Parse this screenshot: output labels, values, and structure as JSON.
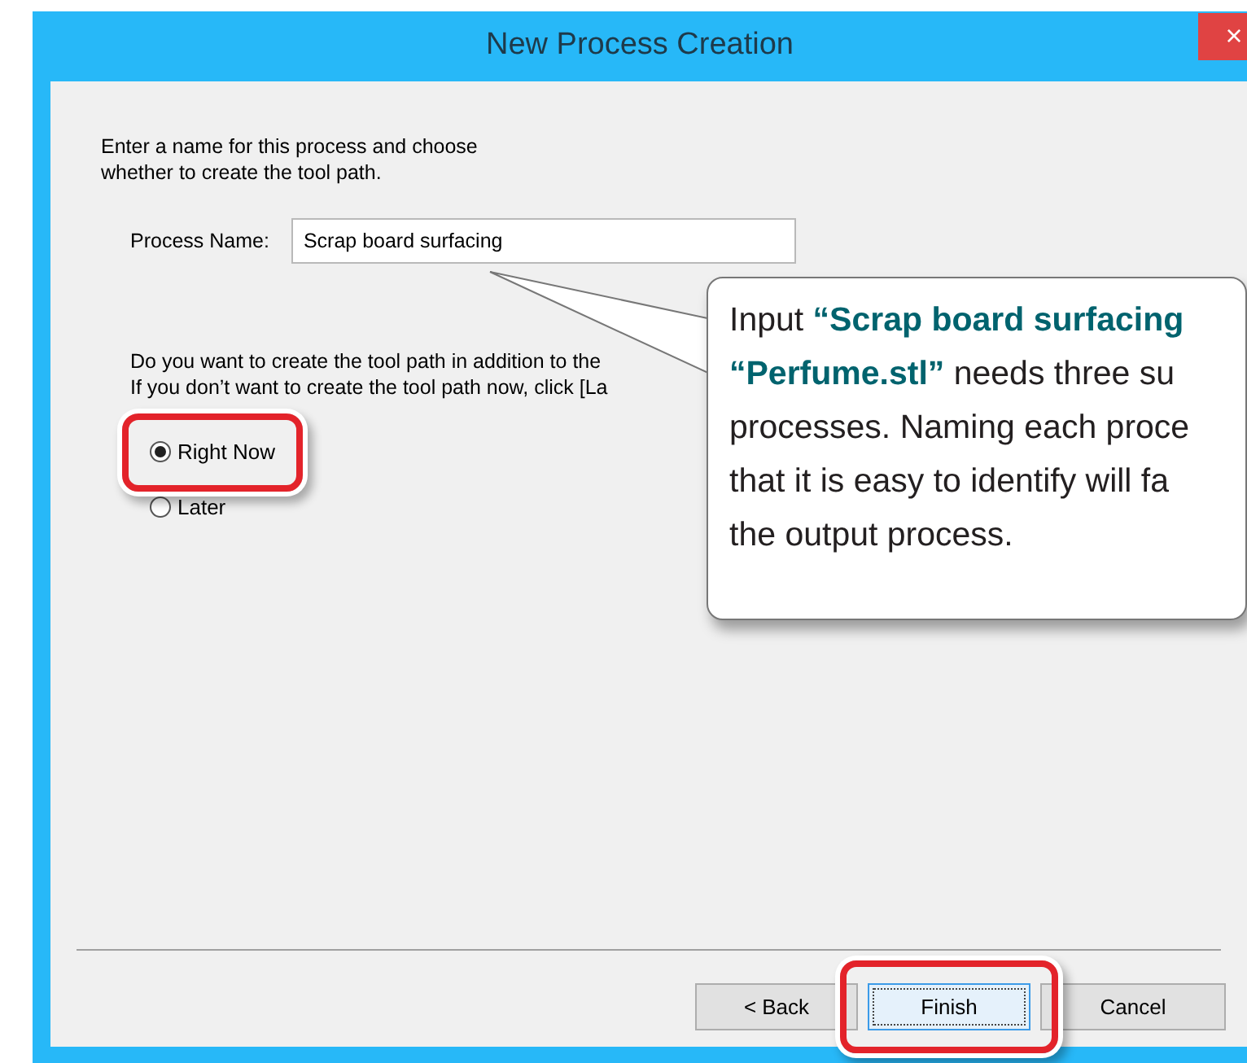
{
  "window": {
    "title": "New Process Creation",
    "close": "×"
  },
  "intro": [
    "Enter a name for this process and choose",
    "whether to create the tool path."
  ],
  "process_name": {
    "label": "Process Name:",
    "value": "Scrap board surfacing"
  },
  "question": [
    "Do you want to create the tool path in addition to the",
    "If you don’t want to create the tool path now, click [La"
  ],
  "options": [
    {
      "label": "Right Now",
      "selected": true,
      "highlighted": true
    },
    {
      "label": "Later",
      "selected": false,
      "highlighted": false
    }
  ],
  "buttons": [
    {
      "label": "< Back",
      "default": false,
      "highlighted": false
    },
    {
      "label": "Finish",
      "default": true,
      "highlighted": true
    },
    {
      "label": "Cancel",
      "default": false,
      "highlighted": false
    }
  ],
  "callout": [
    "Input **“Scrap board surfacing**",
    "**“Perfume.stl”** needs three su",
    "processes. Naming each proce",
    "that it is easy to identify will fa",
    "the output process."
  ]
}
